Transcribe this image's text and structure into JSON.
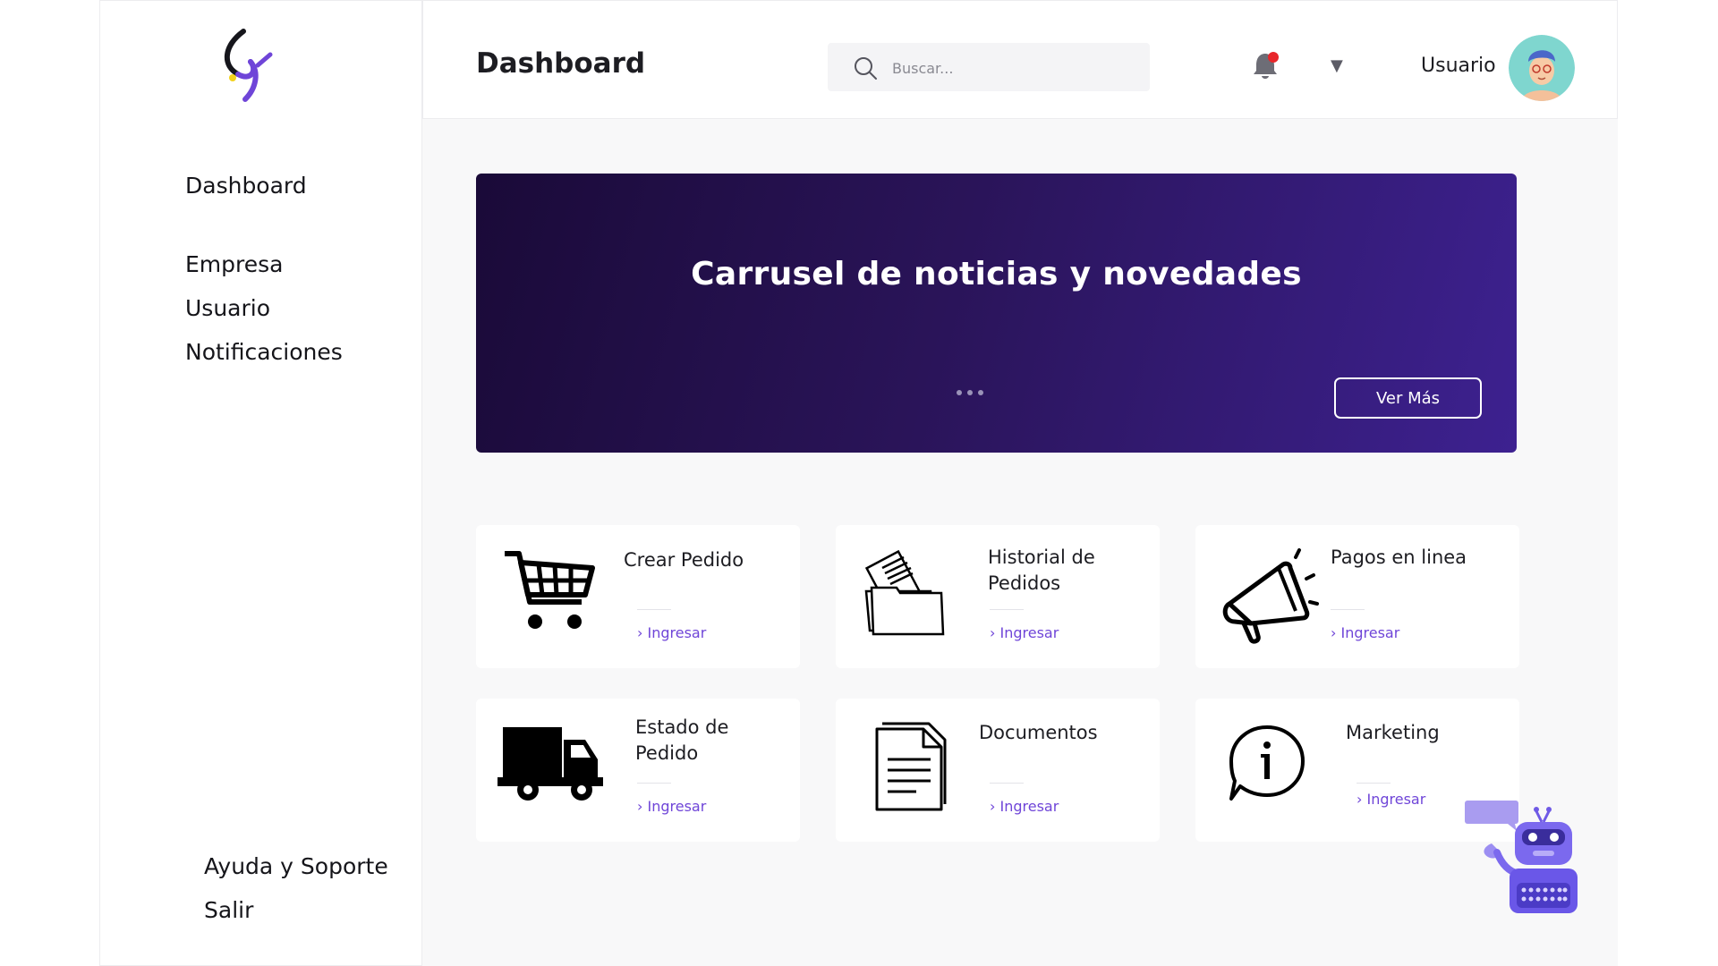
{
  "sidebar": {
    "items": [
      {
        "label": "Dashboard"
      },
      {
        "label": "Empresa"
      },
      {
        "label": "Usuario"
      },
      {
        "label": "Notificaciones"
      }
    ],
    "bottom": [
      {
        "label": "Ayuda y Soporte"
      },
      {
        "label": "Salir"
      }
    ]
  },
  "header": {
    "title": "Dashboard",
    "search_placeholder": "Buscar...",
    "user_name": "Usuario",
    "caret": "▼"
  },
  "banner": {
    "title": "Carrusel de noticias y novedades",
    "button_label": "Ver Más"
  },
  "cards": [
    {
      "title": "Crear Pedido",
      "link": "› Ingresar",
      "icon": "shopping-cart-icon"
    },
    {
      "title": "Historial de Pedidos",
      "link": "› Ingresar",
      "icon": "folder-documents-icon"
    },
    {
      "title": "Pagos en linea",
      "link": "› Ingresar",
      "icon": "megaphone-icon"
    },
    {
      "title": "Estado de Pedido",
      "link": "› Ingresar",
      "icon": "delivery-truck-icon"
    },
    {
      "title": "Documentos",
      "link": "› Ingresar",
      "icon": "document-icon"
    },
    {
      "title": "Marketing",
      "link": "› Ingresar",
      "icon": "info-chat-icon"
    }
  ],
  "colors": {
    "accent": "#6f45d8",
    "banner_start": "#1a0a38",
    "banner_end": "#3d2190",
    "notification_dot": "#e8262a"
  }
}
